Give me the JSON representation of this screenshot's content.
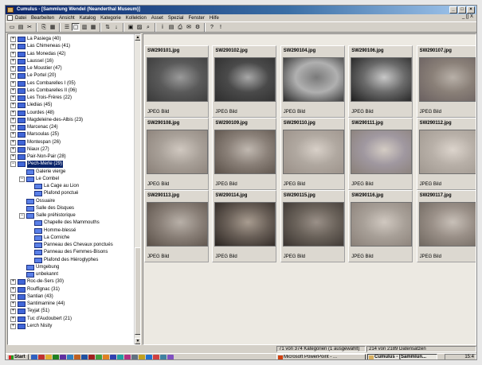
{
  "window": {
    "title": "Cumulus - [Sammlung Wendel (Neanderthal Museum)]",
    "buttons": [
      "_",
      "□",
      "×"
    ]
  },
  "menubar": {
    "items": [
      "Datei",
      "Bearbeiten",
      "Ansicht",
      "Katalog",
      "Kategorie",
      "Kollektion",
      "Asset",
      "Spezial",
      "Fenster",
      "Hilfe"
    ],
    "mdi_control": "_ [] X"
  },
  "toolbar": {
    "icons": [
      "new-icon",
      "open-icon",
      "cut-icon",
      "copy-icon",
      "paste-icon",
      "details-view-icon",
      "thumbnail-view-icon",
      "list-view-icon",
      "grid-view-icon",
      "sort-icon",
      "sort-desc-icon",
      "preview-icon",
      "image-icon",
      "search-icon",
      "info-icon",
      "catalog-icon",
      "print-icon",
      "mail-icon",
      "settings-icon",
      "help-icon",
      "pin-icon"
    ]
  },
  "tree": {
    "items": [
      {
        "label": "La Pasiega (40)",
        "level": 0,
        "expander": "+"
      },
      {
        "label": "Las Chimeneas (41)",
        "level": 0,
        "expander": "+"
      },
      {
        "label": "Las Monedas (42)",
        "level": 0,
        "expander": "+"
      },
      {
        "label": "Laussel (16)",
        "level": 0,
        "expander": "+"
      },
      {
        "label": "Le Moustier (47)",
        "level": 0,
        "expander": "+"
      },
      {
        "label": "Le Portel (20)",
        "level": 0,
        "expander": "+"
      },
      {
        "label": "Les Combarelles I (05)",
        "level": 0,
        "expander": "+"
      },
      {
        "label": "Les Combarelles II (06)",
        "level": 0,
        "expander": "+"
      },
      {
        "label": "Les Trois-Frères (22)",
        "level": 0,
        "expander": "+"
      },
      {
        "label": "Lledias (45)",
        "level": 0,
        "expander": "+"
      },
      {
        "label": "Lourdes (48)",
        "level": 0,
        "expander": "+"
      },
      {
        "label": "Magdeleine-des-Albis (23)",
        "level": 0,
        "expander": "+"
      },
      {
        "label": "Marcenac (24)",
        "level": 0,
        "expander": "+"
      },
      {
        "label": "Marsoulas (25)",
        "level": 0,
        "expander": "+"
      },
      {
        "label": "Montespan (26)",
        "level": 0,
        "expander": "+"
      },
      {
        "label": "Niaux (27)",
        "level": 0,
        "expander": "+"
      },
      {
        "label": "Pair-Non-Pair (28)",
        "level": 0,
        "expander": "+"
      },
      {
        "label": "Pech-Merle (29)",
        "level": 0,
        "expander": "−",
        "selected": true
      },
      {
        "label": "Galerie vierge",
        "level": 1,
        "expander": ""
      },
      {
        "label": "Le Combel",
        "level": 1,
        "expander": "−"
      },
      {
        "label": "La Cage au Lion",
        "level": 2,
        "expander": ""
      },
      {
        "label": "Plafond ponctué",
        "level": 2,
        "expander": ""
      },
      {
        "label": "Ossuaire",
        "level": 1,
        "expander": ""
      },
      {
        "label": "Salle des Disques",
        "level": 1,
        "expander": ""
      },
      {
        "label": "Salle préhistorique",
        "level": 1,
        "expander": "−"
      },
      {
        "label": "Chapelle des Mammouths",
        "level": 2,
        "expander": ""
      },
      {
        "label": "Homme-blessé",
        "level": 2,
        "expander": ""
      },
      {
        "label": "La Corniche",
        "level": 2,
        "expander": ""
      },
      {
        "label": "Panneau des Chevaux ponctués",
        "level": 2,
        "expander": ""
      },
      {
        "label": "Panneau des Femmes-Bisons",
        "level": 2,
        "expander": ""
      },
      {
        "label": "Plafond des Hiéroglyphes",
        "level": 2,
        "expander": ""
      },
      {
        "label": "Umgebung",
        "level": 1,
        "expander": ""
      },
      {
        "label": "unbekannt",
        "level": 1,
        "expander": ""
      },
      {
        "label": "Roc-de-Sers (30)",
        "level": 0,
        "expander": "+"
      },
      {
        "label": "Rouffignac (31)",
        "level": 0,
        "expander": "+"
      },
      {
        "label": "Santian (43)",
        "level": 0,
        "expander": "+"
      },
      {
        "label": "Santimamine (44)",
        "level": 0,
        "expander": "+"
      },
      {
        "label": "Teyjat (51)",
        "level": 0,
        "expander": "+"
      },
      {
        "label": "Tuc d'Audoubert (21)",
        "level": 0,
        "expander": "+"
      },
      {
        "label": "Lerch Nisity",
        "level": 0,
        "expander": "+"
      }
    ]
  },
  "assets": [
    {
      "name": "SW290101.jpg",
      "type": "JPEG Bild",
      "tone": [
        "#3a3a3a",
        "#9a9a9a",
        "#5a5a5a"
      ]
    },
    {
      "name": "SW290102.jpg",
      "type": "JPEG Bild",
      "tone": [
        "#2e2e2e",
        "#a8a8a8",
        "#4a4a4a"
      ]
    },
    {
      "name": "SW290104.jpg",
      "type": "JPEG Bild",
      "tone": [
        "#2a2a2a",
        "#7a7a7a",
        "#b0b0b0"
      ]
    },
    {
      "name": "SW290106.jpg",
      "type": "JPEG Bild",
      "tone": [
        "#1e1e1e",
        "#c8c8c8",
        "#6a6a6a"
      ]
    },
    {
      "name": "SW290107.jpg",
      "type": "JPEG Bild",
      "tone": [
        "#6a6060",
        "#b8b0a8",
        "#8a8078"
      ]
    },
    {
      "name": "SW290108.jpg",
      "type": "JPEG Bild",
      "tone": [
        "#8a8078",
        "#d0c8c0",
        "#a8a098"
      ]
    },
    {
      "name": "SW290109.jpg",
      "type": "JPEG Bild",
      "tone": [
        "#5a5048",
        "#c0b8b0",
        "#8a8078"
      ]
    },
    {
      "name": "SW290110.jpg",
      "type": "JPEG Bild",
      "tone": [
        "#9a9088",
        "#d8d0c8",
        "#b0a8a0"
      ]
    },
    {
      "name": "SW290111.jpg",
      "type": "JPEG Bild",
      "tone": [
        "#8a8078",
        "#d4ccc4",
        "#a098a0"
      ]
    },
    {
      "name": "SW290112.jpg",
      "type": "JPEG Bild",
      "tone": [
        "#a09890",
        "#dcd4cc",
        "#b8b0a8"
      ]
    },
    {
      "name": "SW290113.jpg",
      "type": "JPEG Bild",
      "tone": [
        "#5a5048",
        "#b8b0a8",
        "#8a8078"
      ]
    },
    {
      "name": "SW290114.jpg",
      "type": "JPEG Bild",
      "tone": [
        "#2a2420",
        "#a89c90",
        "#6a6058"
      ]
    },
    {
      "name": "SW290115.jpg",
      "type": "JPEG Bild",
      "tone": [
        "#3a3430",
        "#9a9088",
        "#6a625a"
      ]
    },
    {
      "name": "SW290116.jpg",
      "type": "JPEG Bild",
      "tone": [
        "#8a8078",
        "#d0c8c0",
        "#a8a098"
      ]
    },
    {
      "name": "SW290117.jpg",
      "type": "JPEG Bild",
      "tone": [
        "#706860",
        "#c8c0b8",
        "#9a9088"
      ]
    }
  ],
  "status": {
    "categories": "71 von 374 Kategorien (1 ausgewählt)",
    "records": "214 von 2189 Datensätzen"
  },
  "taskbar": {
    "start": "Start",
    "tasks": [
      {
        "label": "Microsoft PowerPoint - ...",
        "active": false
      },
      {
        "label": "Cumulus - [Sammlun...",
        "active": true
      }
    ],
    "clock": "15:4"
  },
  "colors": {
    "titlebar_start": "#0a246a",
    "selection": "#0a246a",
    "folder": "#4066d8"
  }
}
